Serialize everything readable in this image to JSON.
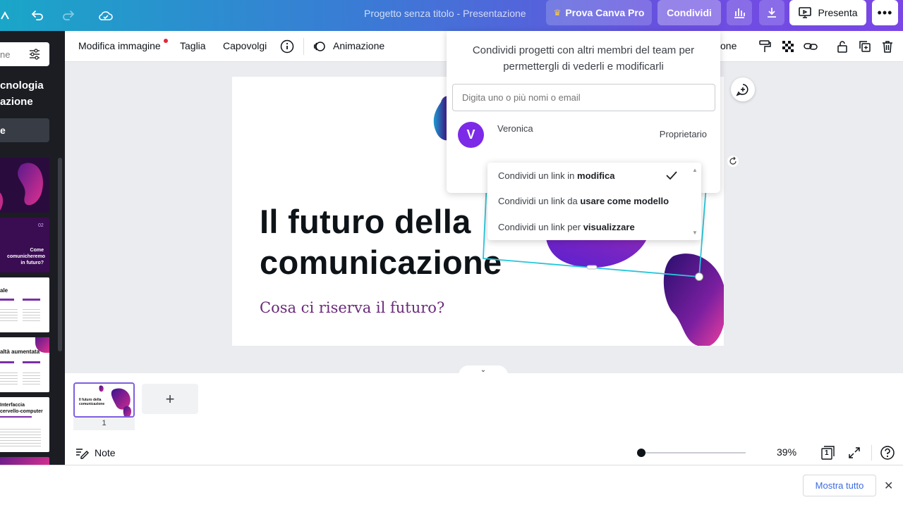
{
  "topbar": {
    "title": "Progetto senza titolo - Presentazione",
    "pro_label": "Prova Canva Pro",
    "share_label": "Condividi",
    "present_label": "Presenta"
  },
  "sidebar": {
    "search_placeholder": "ne",
    "title_line1": "cnologia",
    "title_line2": "azione",
    "button_label": "e",
    "thumb2_num": "02",
    "thumb2_text": "Come comunicheremo in futuro?",
    "thumb3_title": "ale",
    "thumb4_title": "altà aumentata",
    "thumb5_title_line1": "Interfaccia",
    "thumb5_title_line2": "cervello-computer"
  },
  "toolbar": {
    "edit_image": "Modifica immagine",
    "crop": "Taglia",
    "flip": "Capovolgi",
    "animation": "Animazione",
    "position_partial": "one"
  },
  "slide": {
    "title_line1": "Il futuro della",
    "title_line2": "comunicazione",
    "subtitle": "Cosa ci riserva il futuro?"
  },
  "share_panel": {
    "description": "Condividi progetti con altri membri del team per permettergli di vederli e modificarli",
    "input_placeholder": "Digita uno o più nomi o email",
    "owner_initial": "V",
    "owner_name": "Veronica",
    "owner_role": "Proprietario"
  },
  "link_dropdown": {
    "options": [
      {
        "prefix": "Condividi un link in ",
        "bold": "modifica",
        "selected": true
      },
      {
        "prefix": "Condividi un link da ",
        "bold": "usare come modello",
        "selected": false
      },
      {
        "prefix": "Condividi un link per ",
        "bold": "visualizzare",
        "selected": false
      }
    ]
  },
  "pages": {
    "page_number": "1",
    "thumb_title": "Il futuro della comunicazione"
  },
  "bottombar": {
    "notes_label": "Note",
    "zoom_value": "39%",
    "zoom_fraction": 0.03,
    "page_count": "1"
  },
  "notification": {
    "show_all_label": "Mostra tutto"
  },
  "colors": {
    "accent": "#7c2ae8",
    "selection": "#27c6da",
    "link": "#3c6ae0"
  }
}
